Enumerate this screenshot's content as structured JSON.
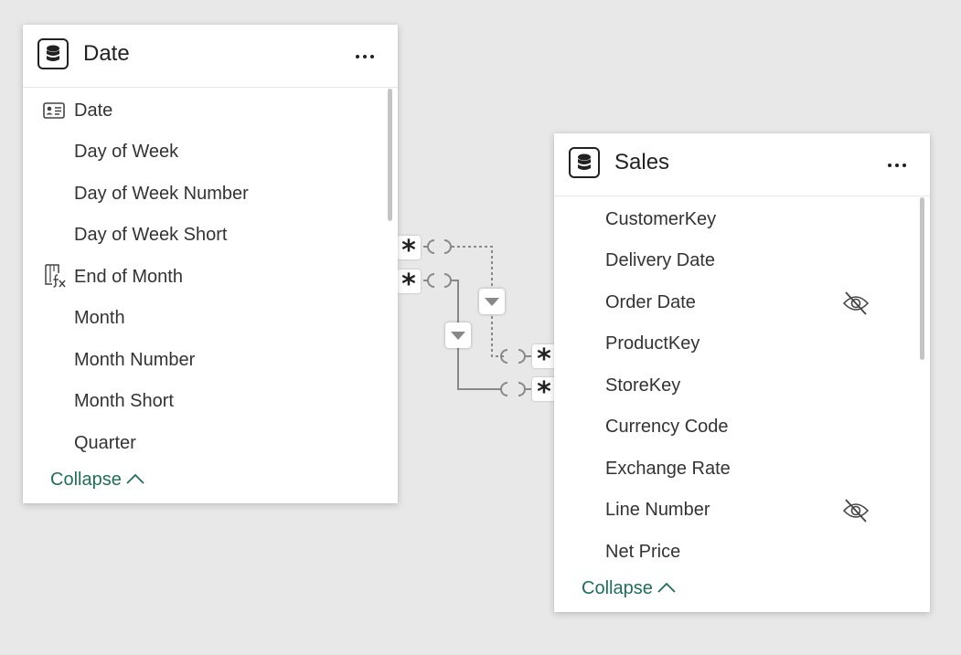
{
  "date_table": {
    "title": "Date",
    "icon": "table-icon",
    "fields": [
      {
        "label": "Date",
        "icon": "key-card-icon"
      },
      {
        "label": "Day of Week"
      },
      {
        "label": "Day of Week Number"
      },
      {
        "label": "Day of Week Short"
      },
      {
        "label": "End of Month",
        "icon": "calculated-column-icon"
      },
      {
        "label": "Month"
      },
      {
        "label": "Month Number"
      },
      {
        "label": "Month Short"
      },
      {
        "label": "Quarter"
      }
    ],
    "collapse_label": "Collapse"
  },
  "sales_table": {
    "title": "Sales",
    "icon": "table-icon",
    "fields": [
      {
        "label": "CustomerKey"
      },
      {
        "label": "Delivery Date"
      },
      {
        "label": "Order Date",
        "hidden": true
      },
      {
        "label": "ProductKey"
      },
      {
        "label": "StoreKey"
      },
      {
        "label": "Currency Code"
      },
      {
        "label": "Exchange Rate"
      },
      {
        "label": "Line Number",
        "hidden": true
      },
      {
        "label": "Net Price"
      }
    ],
    "collapse_label": "Collapse"
  },
  "relationships": [
    {
      "from": "Date",
      "to": "Sales",
      "from_cardinality": "*",
      "to_cardinality": "*",
      "style": "inactive-dashed"
    },
    {
      "from": "Date",
      "to": "Sales",
      "from_cardinality": "*",
      "to_cardinality": "*",
      "style": "active-solid"
    }
  ],
  "colors": {
    "background": "#e8e8e8",
    "collapse_link": "#1e6e5a",
    "line": "#888888"
  }
}
